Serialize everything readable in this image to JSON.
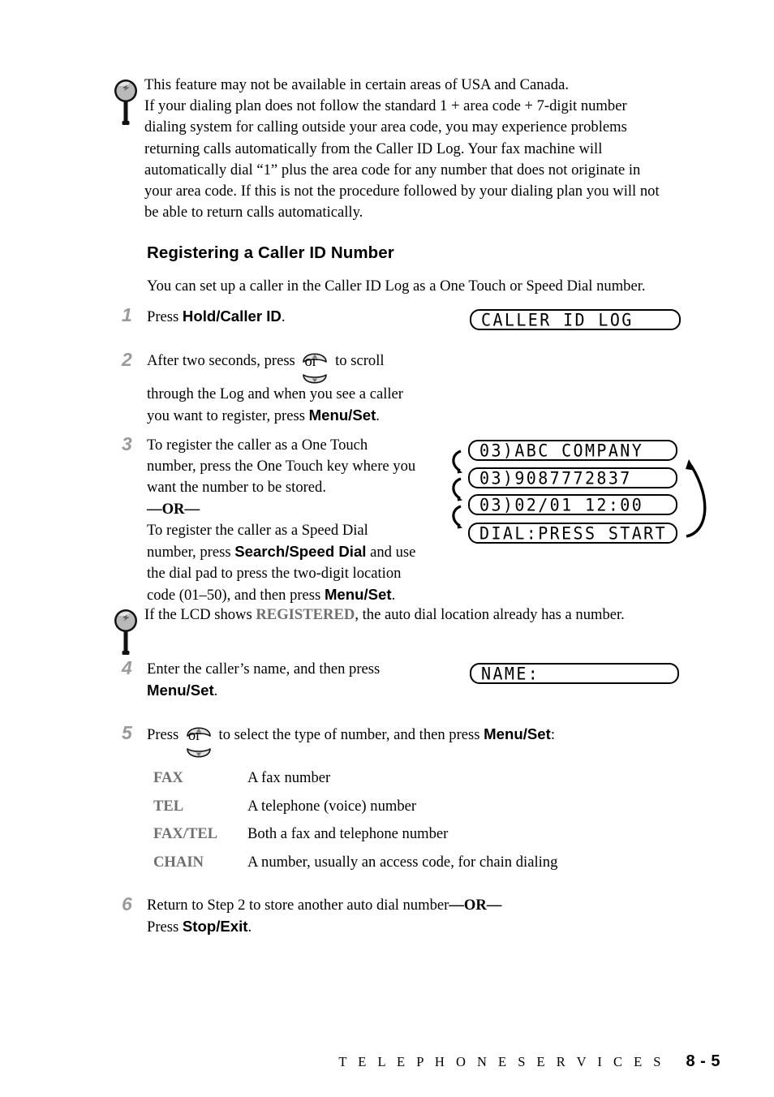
{
  "notes": [
    {
      "icon": "magnifier-note-icon",
      "lines": [
        "This feature may not be available in certain areas of USA and Canada.",
        "If your dialing plan does not follow the standard 1 + area code + 7-digit number",
        "dialing system for calling outside your area code, you may experience problems",
        "returning calls automatically from the Caller ID Log. Your fax machine will",
        "automatically dial “1” plus the area code for any number that does not originate in",
        "your area code. If this is not the procedure followed by your dialing plan you will not",
        "be able to return calls automatically."
      ]
    }
  ],
  "heading": "Registering a Caller ID Number",
  "intro": "You can set up a caller in the Caller ID Log as a One Touch or Speed Dial number.",
  "steps": {
    "one": {
      "number": "1",
      "pre": "Press ",
      "key": "Hold/Caller ID",
      "post": "."
    },
    "two": {
      "number": "2",
      "pre": "After two seconds, press ",
      "icon_label": "or",
      "post": " to scroll",
      "line2": "through the Log and when you see a caller",
      "line3_pre": "you want to register, press ",
      "line3_key": "Menu/Set",
      "line3_post": "."
    },
    "three": {
      "number": "3",
      "line1": "To register the caller as a One Touch",
      "line2": "number, press the One Touch key where you",
      "line3": "want the number to be stored.",
      "or_divider": "—OR—",
      "line4": "To register the caller as a Speed Dial",
      "line5_pre": "number, press ",
      "line5_key": "Search/Speed Dial",
      "line5_post": " and use",
      "line6": "the dial pad to press the two-digit location",
      "line7_pre": "code (01–50), and then press ",
      "line7_key": "Menu/Set",
      "line7_post": "."
    },
    "four": {
      "number": "4",
      "line1": "Enter the caller’s name, and then press",
      "line2_key": "Menu/Set",
      "line2_post": "."
    },
    "five": {
      "number": "5",
      "pre": "Press ",
      "icon_label": "or",
      "mid": " to select the type of number, and then press ",
      "key": "Menu/Set",
      "post": ":"
    },
    "six": {
      "number": "6",
      "line1_pre": "Return to Step 2 to store another auto dial number",
      "line1_or": "—OR—",
      "line2_pre": "Press ",
      "line2_key": "Stop/Exit",
      "line2_post": "."
    }
  },
  "registered_note": {
    "icon": "magnifier-note-icon",
    "pre": "If the LCD shows ",
    "keyword": "REGISTERED",
    "post": ", the auto dial location already has a number."
  },
  "lcds": {
    "caller_id_log": "CALLER ID LOG",
    "cycle": [
      "03)ABC COMPANY",
      "03)9087772837",
      "03)02/01 12:00",
      "DIAL:PRESS START"
    ],
    "name": "NAME:"
  },
  "type_table": {
    "rows": [
      {
        "key": "FAX",
        "desc": "A fax number"
      },
      {
        "key": "TEL",
        "desc": "A telephone (voice) number"
      },
      {
        "key": "FAX/TEL",
        "desc": "Both a fax and telephone number"
      },
      {
        "key": "CHAIN",
        "desc": "A number, usually an access code, for chain dialing"
      }
    ]
  },
  "footer": {
    "title": "T E L E P H O N E   S E R V I C E S",
    "page": "8 - 5"
  },
  "colors": {
    "step_number": "#9a9a9a",
    "grey_keyword": "#6f6f6f",
    "text": "#000000",
    "background": "#ffffff"
  }
}
